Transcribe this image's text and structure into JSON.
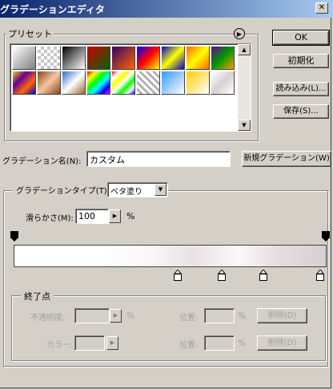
{
  "window": {
    "title": "グラデーションエディタ",
    "close_glyph": "✕"
  },
  "buttons": {
    "ok": "OK",
    "reset": "初期化",
    "load": "読み込み(L)...",
    "save": "保存(S)...",
    "new_gradient": "新規グラデーション(W)"
  },
  "presets": {
    "label": "プリセット",
    "menu_icon": "▶",
    "swatches": [
      {
        "name": "foreground-to-background",
        "bg": "linear-gradient(135deg,#ffffff,#808080)"
      },
      {
        "name": "foreground-to-transparent",
        "bg": "checker"
      },
      {
        "name": "black-white",
        "bg": "linear-gradient(135deg,#000000,#ffffff)"
      },
      {
        "name": "red-green",
        "bg": "linear-gradient(135deg,#cc0000,#006600)"
      },
      {
        "name": "violet-orange",
        "bg": "linear-gradient(135deg,#330066,#ff6600)"
      },
      {
        "name": "blue-red-yellow",
        "bg": "linear-gradient(135deg,#0000ff,#ff0000,#ffff00)"
      },
      {
        "name": "blue-yellow-blue",
        "bg": "linear-gradient(135deg,#0000cc,#ffff00,#0000cc)"
      },
      {
        "name": "orange-yellow-orange",
        "bg": "linear-gradient(135deg,#ff6600,#ffff00,#ff6600)"
      },
      {
        "name": "violet-green-orange",
        "bg": "linear-gradient(135deg,#660099,#009900,#ff9900)"
      },
      {
        "name": "yellow-violet-orange-blue",
        "bg": "linear-gradient(135deg,#ffcc00,#660099,#ff6600,#0000cc)"
      },
      {
        "name": "copper",
        "bg": "linear-gradient(135deg,#8b4513,#f5c6a5,#8b4513)"
      },
      {
        "name": "chrome",
        "bg": "linear-gradient(135deg,#3366cc,#ffffff,#996633)"
      },
      {
        "name": "spectrum",
        "bg": "linear-gradient(135deg,#ff0000,#ffff00,#00ff00,#00ffff,#0000ff,#ff00ff)"
      },
      {
        "name": "transparent-rainbow",
        "bg": "linear-gradient(135deg,#ff0000,#ffffff,#ffff00,#ffffff,#00ff00,#ffffff,#0000ff)"
      },
      {
        "name": "transparent-stripes",
        "bg": "repeating-linear-gradient(45deg,#ffffff 0 3px,#b0b0b0 3px 6px)"
      },
      {
        "name": "blue-white",
        "bg": "linear-gradient(135deg,#3399ff,#ffffff)"
      },
      {
        "name": "yellow-white",
        "bg": "linear-gradient(135deg,#ffcc00,#ffffff)"
      },
      {
        "name": "custom",
        "bg": "linear-gradient(135deg,#ffffff,#d8d0d4,#ffffff)"
      }
    ]
  },
  "name_field": {
    "label": "グラデーション名(N):",
    "value": "カスタム"
  },
  "gradient_type": {
    "label": "グラデーションタイプ(T):",
    "value": "ベタ塗り"
  },
  "smoothness": {
    "label": "滑らかさ(M):",
    "value": "100",
    "unit": "%"
  },
  "stops_group": {
    "label": "終了点",
    "opacity_label": "不透明度:",
    "opacity_unit": "%",
    "location_label": "位置:",
    "location_unit": "%",
    "delete_label": "削除(D)",
    "color_label": "カラー:"
  },
  "colors": {
    "gradient": "linear-gradient(to right,#ffffff 0%,#ffffff 28%,#f8f6f7 45%,#e9e2e5 57%,#fbf9fa 72%,#e6dee1 84%,#d9cfd3 100%)"
  }
}
